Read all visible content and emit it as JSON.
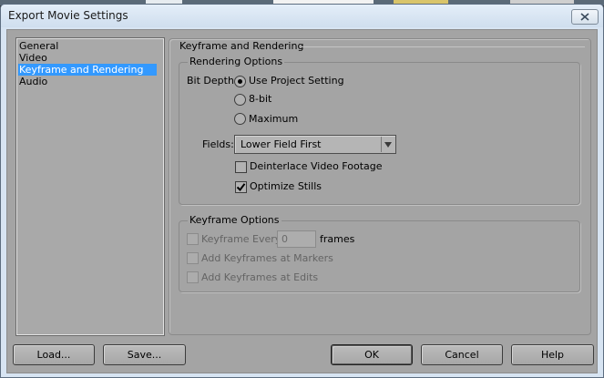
{
  "window": {
    "title": "Export Movie Settings",
    "close_icon": "close-icon"
  },
  "nav": {
    "items": [
      {
        "label": "General",
        "selected": false
      },
      {
        "label": "Video",
        "selected": false
      },
      {
        "label": "Keyframe and Rendering",
        "selected": true
      },
      {
        "label": "Audio",
        "selected": false
      }
    ]
  },
  "panel": {
    "heading": "Keyframe and Rendering",
    "rendering": {
      "title": "Rendering Options",
      "bit_depth_label": "Bit Depth:",
      "bit_depth_options": [
        {
          "label": "Use Project Setting",
          "selected": true
        },
        {
          "label": "8-bit",
          "selected": false
        },
        {
          "label": "Maximum",
          "selected": false
        }
      ],
      "fields_label": "Fields:",
      "fields_value": "Lower Field First",
      "deinterlace_label": "Deinterlace Video Footage",
      "deinterlace_checked": false,
      "optimize_label": "Optimize Stills",
      "optimize_checked": true
    },
    "keyframe": {
      "title": "Keyframe Options",
      "every_label": "Keyframe Every",
      "every_value": "0",
      "every_unit": "frames",
      "markers_label": "Add Keyframes at Markers",
      "edits_label": "Add Keyframes at Edits"
    }
  },
  "buttons": {
    "load": "Load...",
    "save": "Save...",
    "ok": "OK",
    "cancel": "Cancel",
    "help": "Help"
  },
  "colors": {
    "selection": "#3399ff",
    "dialog_background": "#a4a4a4",
    "titlebar": "#d7e4f2"
  }
}
